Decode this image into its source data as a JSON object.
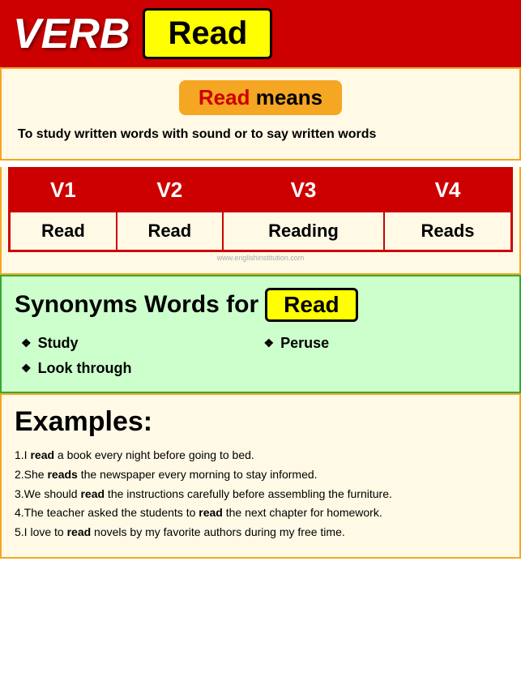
{
  "header": {
    "verb_label": "VERB",
    "word": "Read"
  },
  "meaning": {
    "title_word": "Read",
    "title_rest": " means",
    "definition": "To study written words with sound or to say written words"
  },
  "verb_forms": {
    "headers": [
      "V1",
      "V2",
      "V3",
      "V4"
    ],
    "values": [
      "Read",
      "Read",
      "Reading",
      "Reads"
    ],
    "watermark": "www.englishinstitution.com"
  },
  "synonyms": {
    "title": "Synonyms Words for",
    "word": "Read",
    "items": [
      {
        "text": "Study",
        "col": 1
      },
      {
        "text": "Peruse",
        "col": 2
      },
      {
        "text": "Look through",
        "col": 1
      }
    ]
  },
  "examples": {
    "title": "Examples:",
    "items": [
      {
        "prefix": "1.I ",
        "bold": "read",
        "rest": " a book every night before going to bed."
      },
      {
        "prefix": "2.She ",
        "bold": "reads",
        "rest": " the newspaper every morning to stay informed."
      },
      {
        "prefix": "3.We should ",
        "bold": "read",
        "rest": " the instructions carefully before assembling the furniture."
      },
      {
        "prefix": "4.The teacher asked the students to ",
        "bold": "read",
        "rest": " the next chapter for homework."
      },
      {
        "prefix": "5.I love to ",
        "bold": "read",
        "rest": " novels by my favorite authors during my free time."
      }
    ]
  }
}
